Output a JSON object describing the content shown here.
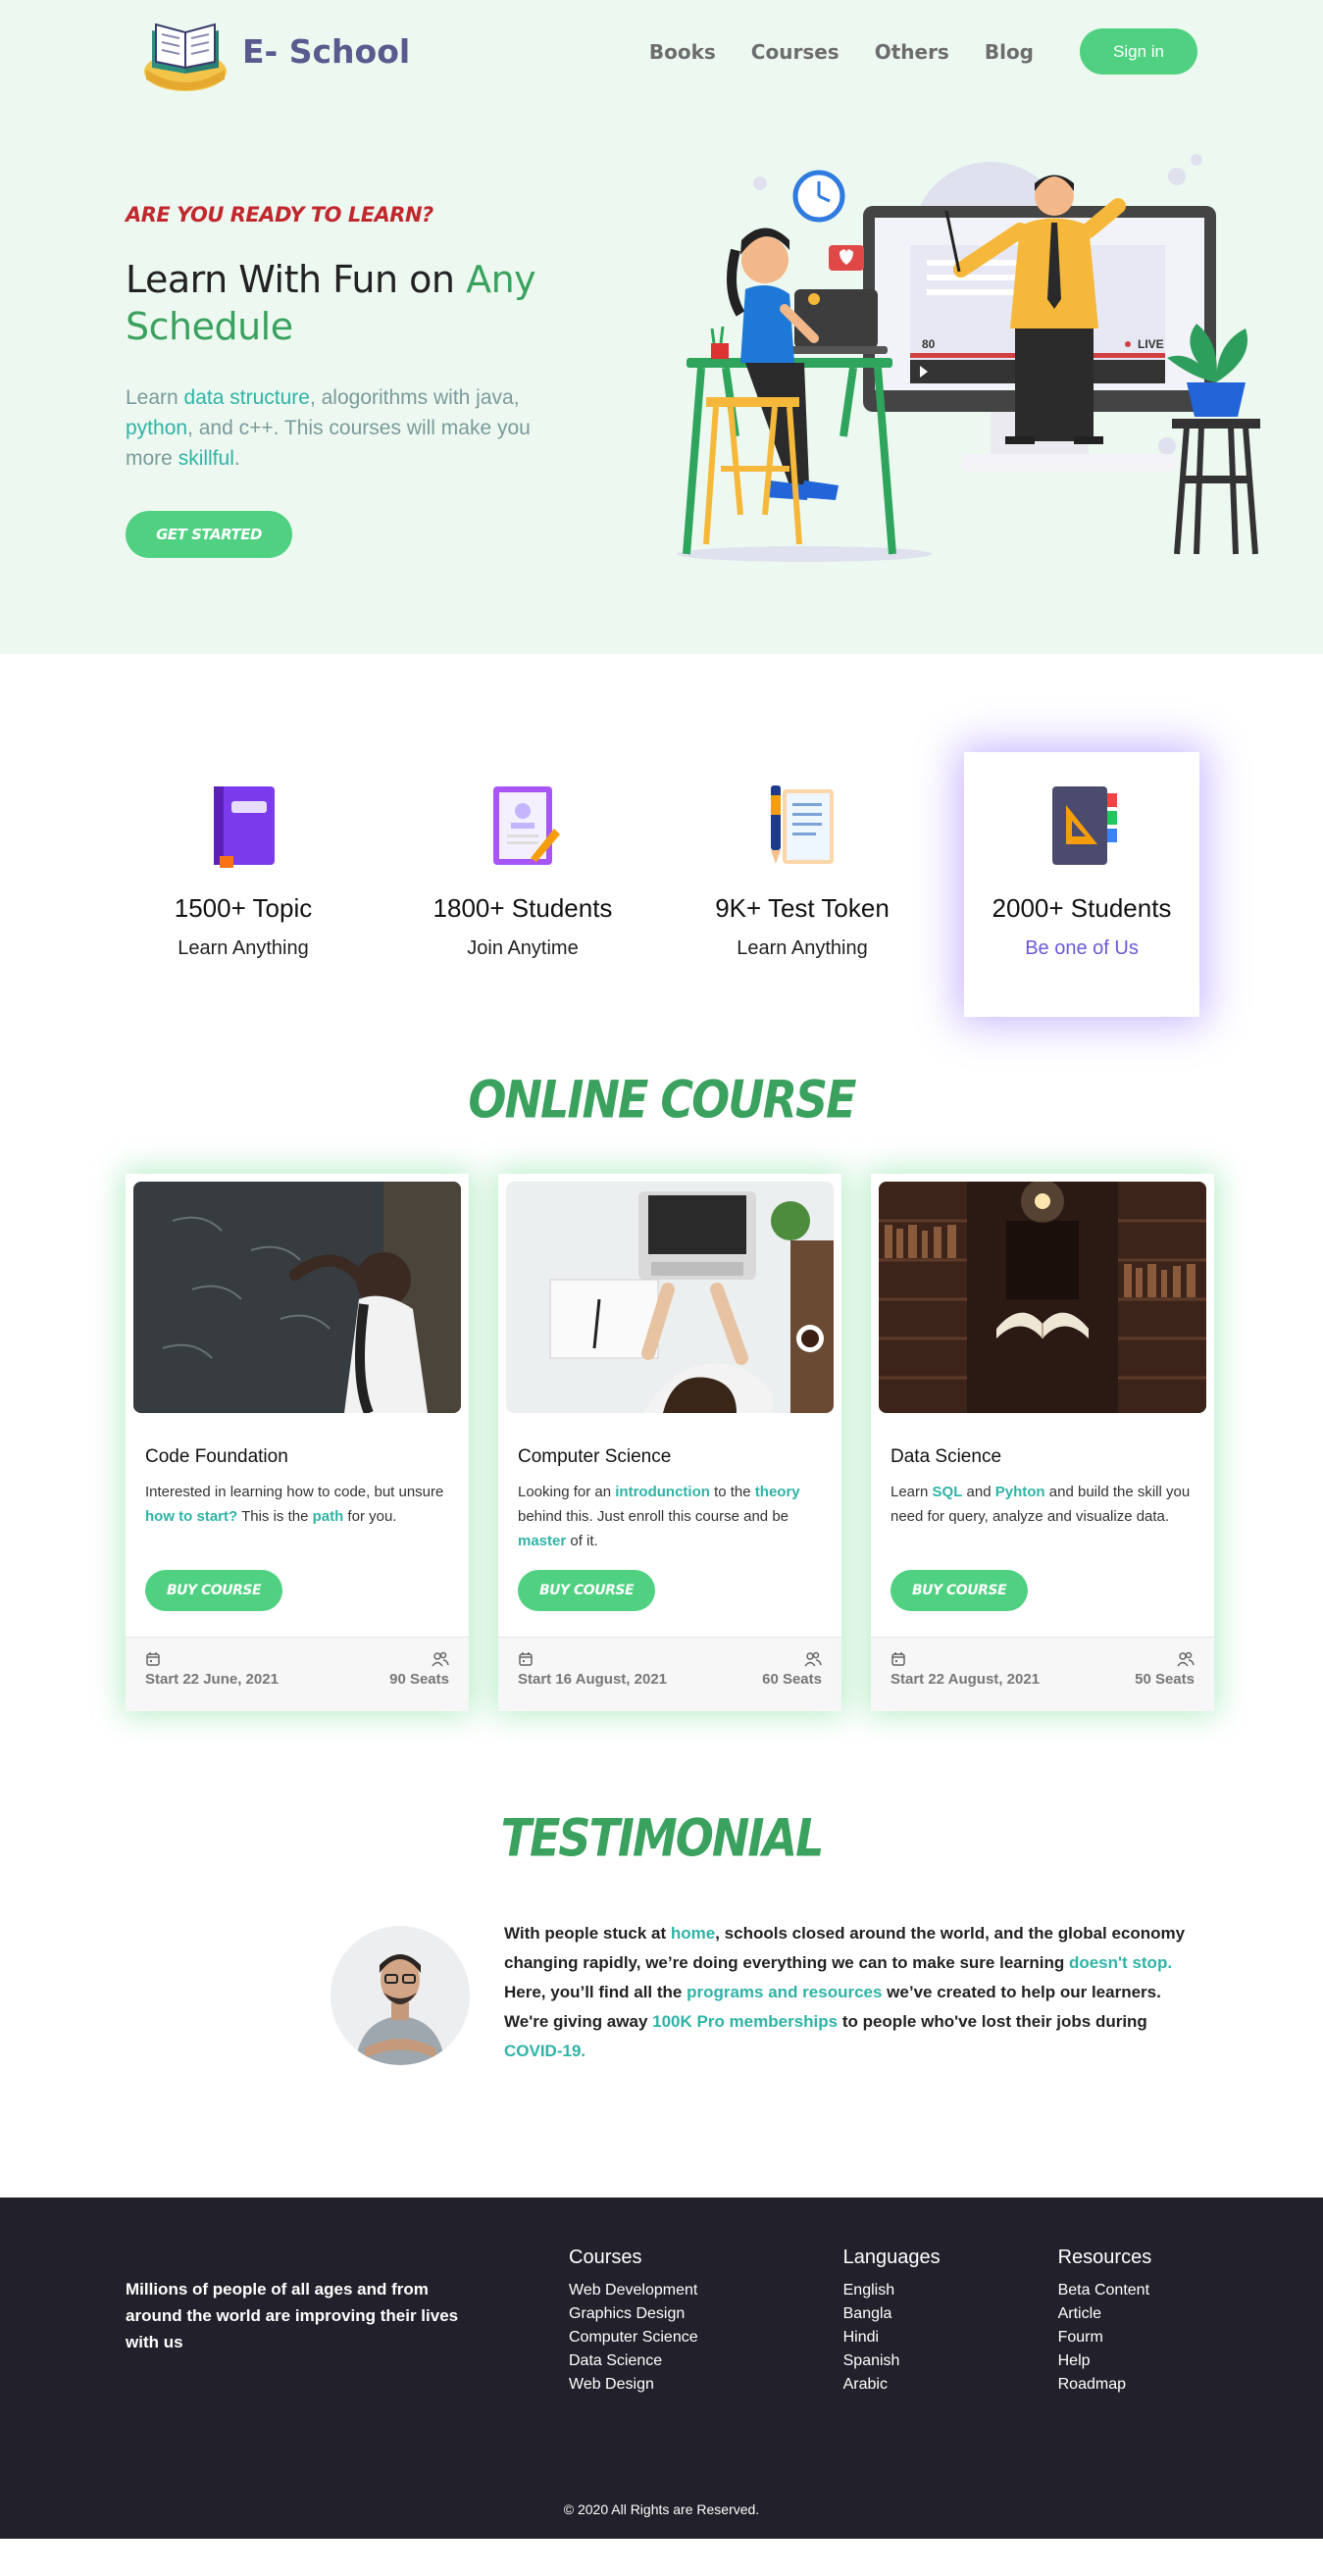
{
  "brand": {
    "name": "E- School",
    "logo_icon": "open-book-icon"
  },
  "nav": {
    "links": [
      "Books",
      "Courses",
      "Others",
      "Blog"
    ],
    "signin_label": "Sign in"
  },
  "hero": {
    "eyebrow": "ARE YOU READY TO LEARN?",
    "title_plain": "Learn With Fun on ",
    "title_accent": "Any Schedule",
    "desc_1": "Learn ",
    "desc_hl_1": "data structure",
    "desc_2": ", alogorithms with java, ",
    "desc_hl_2": "python",
    "desc_3": ", and c++. This courses will make you more ",
    "desc_hl_3": "skillful",
    "desc_4": ".",
    "cta_label": "GET STARTED",
    "illustration": {
      "viewer_count": "80",
      "live_label": "LIVE"
    }
  },
  "stats": [
    {
      "icon": "book-icon",
      "number": "1500+ Topic",
      "sub": "Learn Anything"
    },
    {
      "icon": "id-card-icon",
      "number": "1800+ Students",
      "sub": "Join Anytime"
    },
    {
      "icon": "clipboard-icon",
      "number": "9K+ Test Token",
      "sub": "Learn Anything"
    },
    {
      "icon": "notebook-icon",
      "number": "2000+ Students",
      "sub": "Be one of Us"
    }
  ],
  "courses_section": {
    "title": "ONLINE COURSE",
    "buy_label": "BUY COURSE",
    "cards": [
      {
        "title": "Code Foundation",
        "desc_parts": [
          "Interested in learning how to code, but unsure ",
          "how to start?",
          " This is the ",
          "path",
          " for you."
        ],
        "date": "Start 22 June, 2021",
        "seats": "90 Seats"
      },
      {
        "title": "Computer Science",
        "desc_parts": [
          "Looking for an ",
          "introdunction",
          " to the ",
          "theory",
          " behind this. Just enroll this course and be ",
          "master",
          " of it."
        ],
        "date": "Start 16 August, 2021",
        "seats": "60 Seats"
      },
      {
        "title": "Data Science",
        "desc_parts": [
          "Learn ",
          "SQL",
          " and ",
          "Pyhton",
          " and build the skill you need for query, analyze and visualize data."
        ],
        "date": "Start 22 August, 2021",
        "seats": "50 Seats"
      }
    ]
  },
  "testimonial": {
    "title": "TESTIMONIAL",
    "parts": [
      "With people stuck at ",
      "home",
      ", schools closed around the world, and the global economy changing rapidly, we’re doing everything we can to make sure learning ",
      "doesn't stop.",
      " Here, you’ll find all the ",
      "programs and resources",
      " we’ve created to help our learners. We're giving away ",
      "100K Pro memberships",
      " to people who've lost their jobs during ",
      "COVID-19."
    ]
  },
  "footer": {
    "tagline": "Millions of people of all ages and from around the world are improving their lives with us",
    "columns": [
      {
        "title": "Courses",
        "items": [
          "Web Development",
          "Graphics Design",
          "Computer Science",
          "Data Science",
          "Web Design"
        ]
      },
      {
        "title": "Languages",
        "items": [
          "English",
          "Bangla",
          "Hindi",
          "Spanish",
          "Arabic"
        ]
      },
      {
        "title": "Resources",
        "items": [
          "Beta Content",
          "Article",
          "Fourm",
          "Help",
          "Roadmap"
        ]
      }
    ],
    "copyright": "© 2020 All Rights are Reserved."
  },
  "colors": {
    "accent_green": "#4fd181",
    "title_green": "#3aa15e",
    "highlight_teal": "#2fb3a6",
    "eyebrow_red": "#c0282e",
    "hero_bg": "#edf9f0",
    "footer_bg": "#22212b",
    "featured_purple": "#6a5ad9"
  }
}
